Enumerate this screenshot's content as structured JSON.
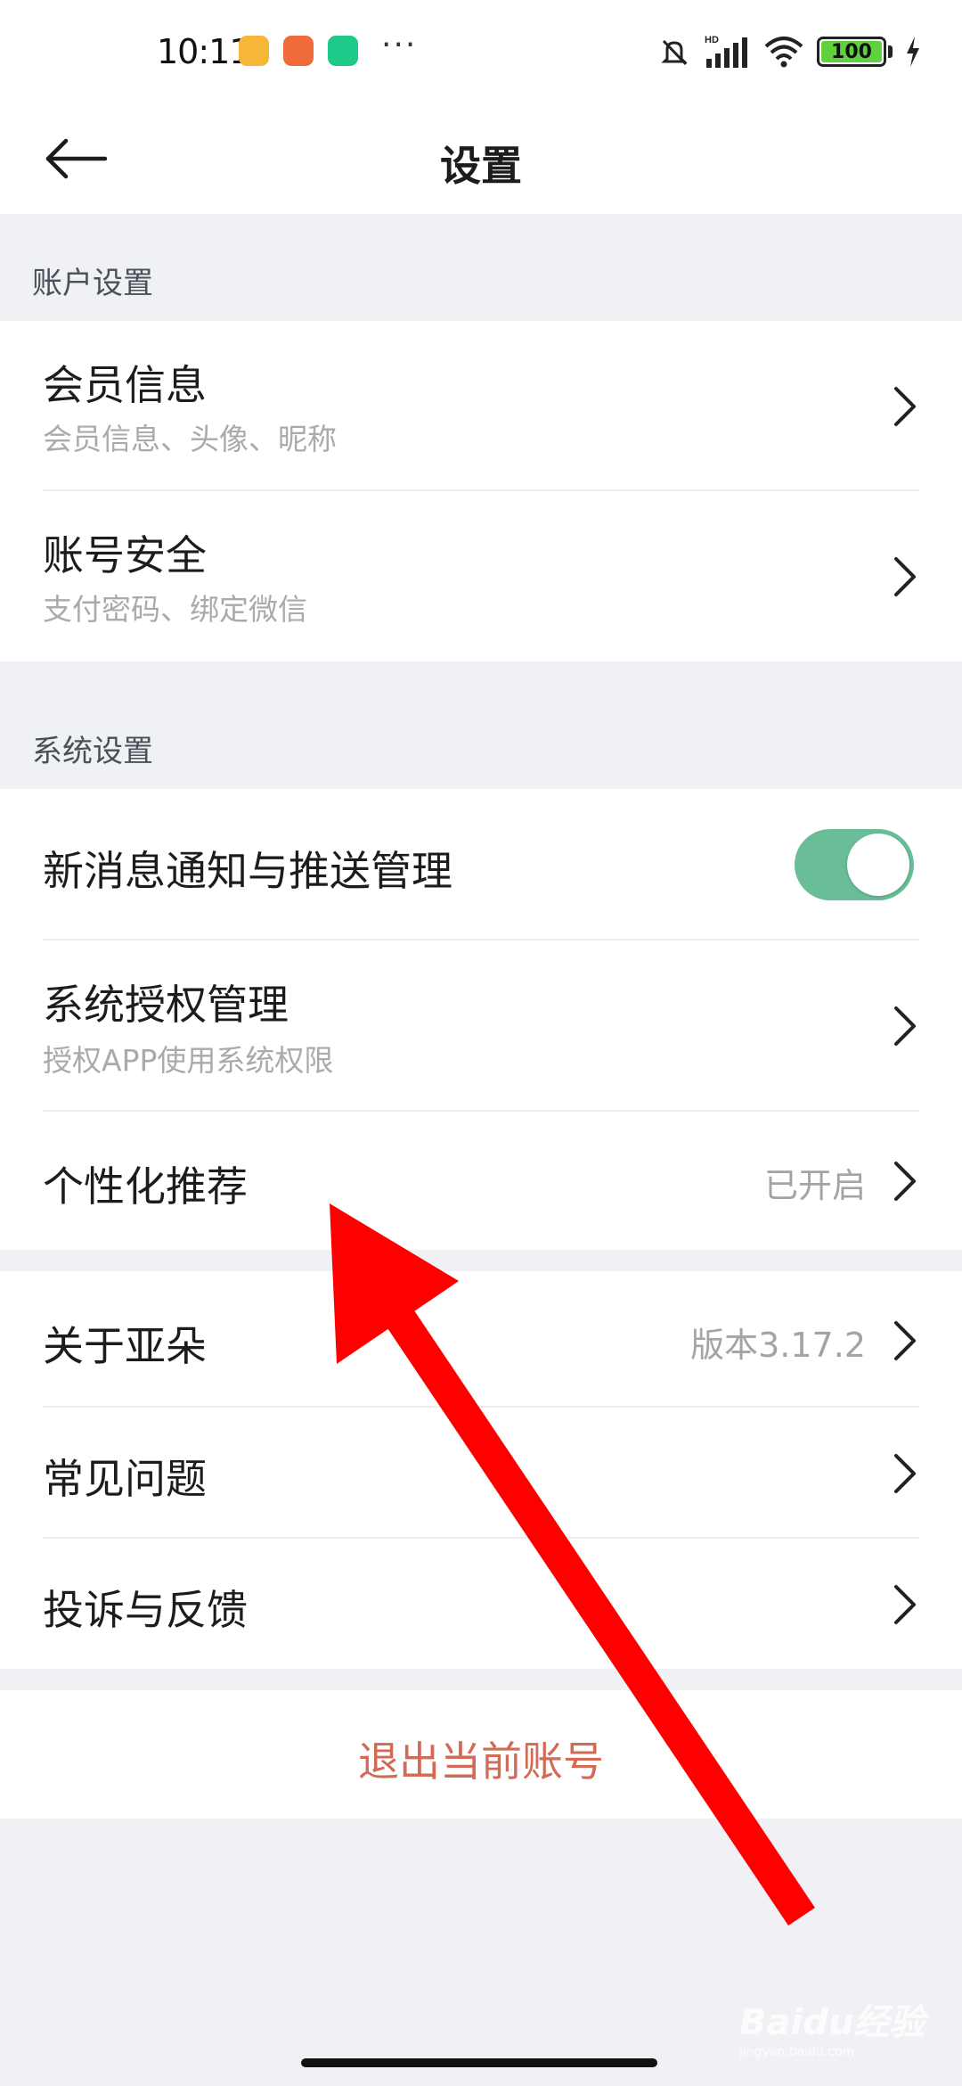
{
  "status_bar": {
    "time": "10:11",
    "network": "HD",
    "battery": "100",
    "more": "···"
  },
  "header": {
    "title": "设置",
    "back_icon": "back-arrow-icon"
  },
  "sections": {
    "account": {
      "label": "账户设置",
      "items": [
        {
          "title": "会员信息",
          "subtitle": "会员信息、头像、昵称"
        },
        {
          "title": "账号安全",
          "subtitle": "支付密码、绑定微信"
        }
      ]
    },
    "system": {
      "label": "系统设置",
      "items": [
        {
          "title": "新消息通知与推送管理",
          "toggle_on": true
        },
        {
          "title": "系统授权管理",
          "subtitle": "授权APP使用系统权限"
        },
        {
          "title": "个性化推荐",
          "value": "已开启"
        }
      ]
    },
    "other": {
      "items": [
        {
          "title": "关于亚朵",
          "value": "版本3.17.2"
        },
        {
          "title": "常见问题"
        },
        {
          "title": "投诉与反馈"
        }
      ]
    }
  },
  "logout": {
    "label": "退出当前账号"
  },
  "watermark": {
    "text": "Baidu经验",
    "sub": "jingyan.baidu.com"
  },
  "colors": {
    "background": "#eff1f5",
    "toggle_on": "#69bd97",
    "logout_text": "#d26a55",
    "annotation_arrow": "#ff0000"
  }
}
